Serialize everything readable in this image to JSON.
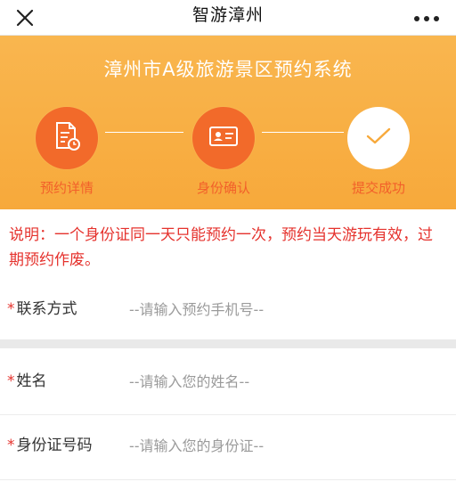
{
  "navbar": {
    "title": "智游漳州",
    "close_icon": "close-icon",
    "more_icon": "more-icon"
  },
  "banner": {
    "title": "漳州市A级旅游景区预约系统",
    "steps": [
      {
        "label": "预约详情",
        "icon": "document-clock-icon",
        "state": "done"
      },
      {
        "label": "身份确认",
        "icon": "id-card-icon",
        "state": "done"
      },
      {
        "label": "提交成功",
        "icon": "checkmark-icon",
        "state": "pending"
      }
    ]
  },
  "notice": "说明：一个身份证同一天只能预约一次，预约当天游玩有效，过期预约作废。",
  "form": {
    "required_mark": "*",
    "phone": {
      "label": "联系方式",
      "placeholder": "--请输入预约手机号--",
      "value": ""
    },
    "name": {
      "label": "姓名",
      "placeholder": "--请输入您的姓名--",
      "value": ""
    },
    "id_number": {
      "label": "身份证号码",
      "placeholder": "--请输入您的身份证--",
      "value": ""
    }
  },
  "colors": {
    "banner_top": "#f9b64f",
    "step_active": "#f26a2a",
    "step_label": "#f2602a",
    "notice_red": "#e5322d"
  }
}
